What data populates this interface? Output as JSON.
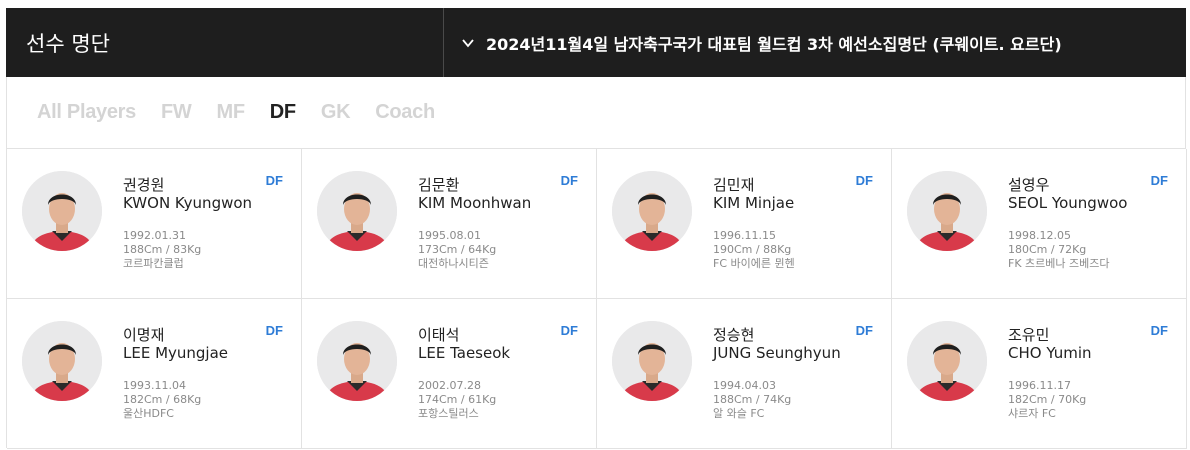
{
  "header": {
    "title": "선수 명단",
    "selector_label": "2024년11월4일 남자축구국가 대표팀 월드컵 3차 예선소집명단 (쿠웨이트. 요르단)"
  },
  "filters": {
    "tabs": [
      {
        "label": "All Players",
        "active": false
      },
      {
        "label": "FW",
        "active": false
      },
      {
        "label": "MF",
        "active": false
      },
      {
        "label": "DF",
        "active": true
      },
      {
        "label": "GK",
        "active": false
      },
      {
        "label": "Coach",
        "active": false
      }
    ]
  },
  "colors": {
    "accent": "#2e7cd6",
    "header_bg": "#1e1e1e",
    "jersey": "#d83a4a"
  },
  "players": [
    {
      "name_ko": "권경원",
      "name_en": "KWON Kyungwon",
      "position": "DF",
      "birth": "1992.01.31",
      "body": "188Cm / 83Kg",
      "club": "코르파칸클럽"
    },
    {
      "name_ko": "김문환",
      "name_en": "KIM Moonhwan",
      "position": "DF",
      "birth": "1995.08.01",
      "body": "173Cm / 64Kg",
      "club": "대전하나시티즌"
    },
    {
      "name_ko": "김민재",
      "name_en": "KIM Minjae",
      "position": "DF",
      "birth": "1996.11.15",
      "body": "190Cm / 88Kg",
      "club": "FC 바이에른 뮌헨"
    },
    {
      "name_ko": "설영우",
      "name_en": "SEOL Youngwoo",
      "position": "DF",
      "birth": "1998.12.05",
      "body": "180Cm / 72Kg",
      "club": "FK 츠르베나 즈베즈다"
    },
    {
      "name_ko": "이명재",
      "name_en": "LEE Myungjae",
      "position": "DF",
      "birth": "1993.11.04",
      "body": "182Cm / 68Kg",
      "club": "울산HDFC"
    },
    {
      "name_ko": "이태석",
      "name_en": "LEE Taeseok",
      "position": "DF",
      "birth": "2002.07.28",
      "body": "174Cm / 61Kg",
      "club": "포항스틸러스"
    },
    {
      "name_ko": "정승현",
      "name_en": "JUNG Seunghyun",
      "position": "DF",
      "birth": "1994.04.03",
      "body": "188Cm / 74Kg",
      "club": "알 와슬 FC"
    },
    {
      "name_ko": "조유민",
      "name_en": "CHO Yumin",
      "position": "DF",
      "birth": "1996.11.17",
      "body": "182Cm / 70Kg",
      "club": "샤르자 FC"
    }
  ]
}
